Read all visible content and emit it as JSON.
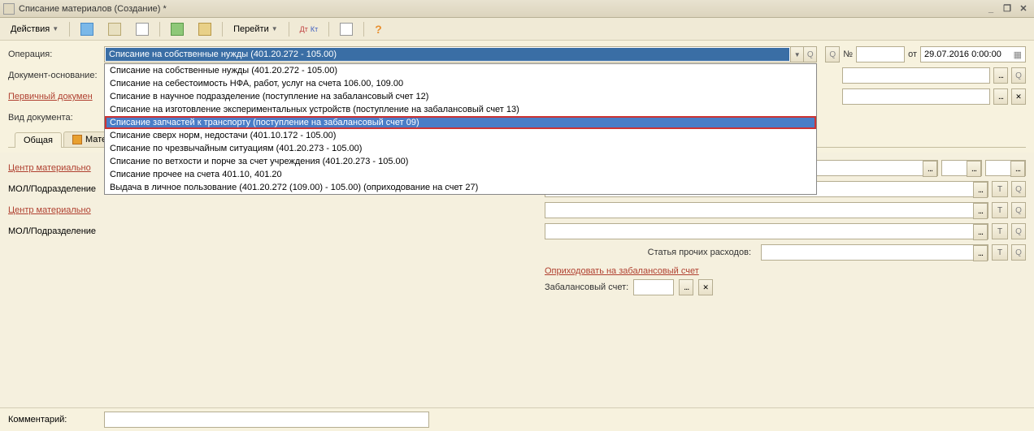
{
  "titlebar": {
    "title": "Списание материалов (Создание) *"
  },
  "toolbar": {
    "actions_label": "Действия",
    "goto_label": "Перейти"
  },
  "form": {
    "operation_label": "Операция:",
    "operation_selected": "Списание на собственные нужды (401.20.272 - 105.00)",
    "doc_basis_label": "Документ-основание:",
    "primary_doc_label": "Первичный докумен",
    "doc_type_label": "Вид документа:",
    "num_label": "№",
    "from_label": "от",
    "date_value": "29.07.2016 0:00:00"
  },
  "dropdown": {
    "items": [
      "Списание на собственные нужды (401.20.272 - 105.00)",
      "Списание на себестоимость НФА, работ, услуг на счета 106.00, 109.00",
      "Списание в научное подразделение (поступление на забалансовый счет 12)",
      "Списание на изготовление экспериментальных устройств (поступление на забалансовый счет 13)",
      "Списание запчастей к транспорту (поступление на забалансовый счет 09)",
      "Списание сверх норм, недостачи (401.10.172 - 105.00)",
      "Списание по чрезвычайным ситуациям (401.20.273 - 105.00)",
      "Списание по ветхости и порче за счет учреждения (401.20.273 - 105.00)",
      "Списание прочее на счета 401.10, 401.20",
      "Выдача в личное пользование (401.20.272 (109.00) - 105.00) (оприходование на счет 27)"
    ],
    "highlighted_index": 4
  },
  "tabs": {
    "tab1": "Общая",
    "tab2": "Мате"
  },
  "left": {
    "center1_label": "Центр материально",
    "mol1_label": "МОЛ/Подразделение",
    "center2_label": "Центр материально",
    "mol2_label": "МОЛ/Подразделение"
  },
  "right": {
    "expense_label": "Статья прочих расходов:",
    "offbalance_section": "Оприходовать на забалансовый счет",
    "offbalance_label": "Забалансовый счет:"
  },
  "bottom": {
    "comment_label": "Комментарий:"
  }
}
